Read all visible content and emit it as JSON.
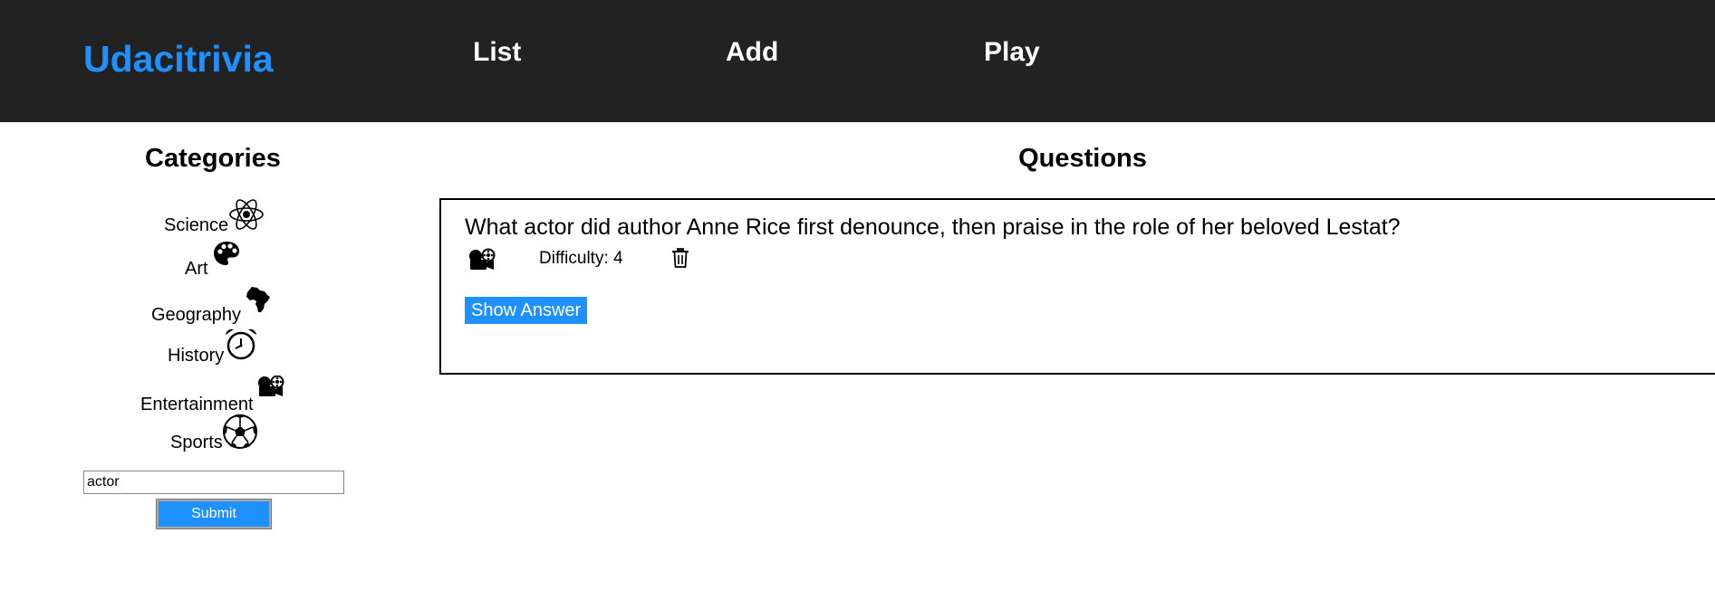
{
  "header": {
    "brand": "Udacitrivia",
    "nav": {
      "list": "List",
      "add": "Add",
      "play": "Play"
    },
    "background_color": "#222222",
    "brand_color": "#1e90ff"
  },
  "sidebar": {
    "title": "Categories",
    "categories": [
      {
        "label": "Science",
        "icon": "atom-icon"
      },
      {
        "label": "Art",
        "icon": "palette-icon"
      },
      {
        "label": "Geography",
        "icon": "africa-map-icon"
      },
      {
        "label": "History",
        "icon": "alarm-clock-icon"
      },
      {
        "label": "Entertainment",
        "icon": "film-projector-icon"
      },
      {
        "label": "Sports",
        "icon": "soccer-ball-icon"
      }
    ],
    "search": {
      "value": "actor",
      "submit_label": "Submit"
    }
  },
  "main": {
    "title": "Questions",
    "questions": [
      {
        "text": "What actor did author Anne Rice first denounce, then praise in the role of her beloved Lestat?",
        "category_icon": "film-projector-icon",
        "difficulty_label": "Difficulty: ",
        "difficulty": "4",
        "delete_icon": "trash-icon",
        "show_answer_label": "Show Answer"
      }
    ]
  },
  "accent_color": "#1e90ff"
}
